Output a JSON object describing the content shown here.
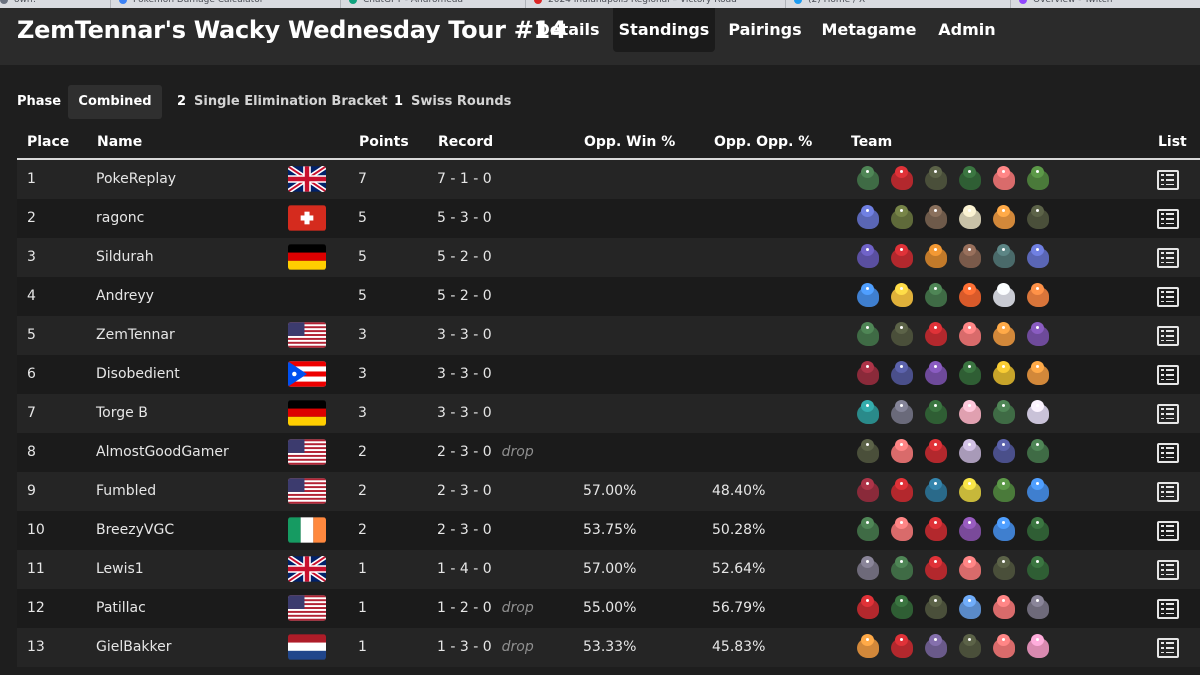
{
  "browser_tabs": [
    {
      "label": "own!",
      "color": "#6b7280"
    },
    {
      "label": "Pokemon Damage Calculator",
      "color": "#3b82f6"
    },
    {
      "label": "ChatGPT - Andromeda",
      "color": "#10a37f"
    },
    {
      "label": "2024 Indianapolis Regional – Victory Road",
      "color": "#dc2626"
    },
    {
      "label": "(2) Home / X",
      "color": "#1d9bf0"
    },
    {
      "label": "Overview - Twitch",
      "color": "#9146ff"
    }
  ],
  "header": {
    "title": "ZemTennar's Wacky Wednesday Tour #14",
    "nav": [
      {
        "label": "Details",
        "active": false
      },
      {
        "label": "Standings",
        "active": true
      },
      {
        "label": "Pairings",
        "active": false
      },
      {
        "label": "Metagame",
        "active": false
      },
      {
        "label": "Admin",
        "active": false
      }
    ]
  },
  "phase": {
    "label": "Phase",
    "options": [
      {
        "number": "",
        "label": "Combined",
        "active": true
      },
      {
        "number": "2",
        "label": "Single Elimination Bracket",
        "active": false
      },
      {
        "number": "1",
        "label": "Swiss Rounds",
        "active": false
      }
    ]
  },
  "table": {
    "columns": {
      "place": "Place",
      "name": "Name",
      "points": "Points",
      "record": "Record",
      "opp_win": "Opp. Win %",
      "opp_opp": "Opp. Opp. %",
      "team": "Team",
      "list": "List"
    },
    "rows": [
      {
        "place": "1",
        "name": "PokeReplay",
        "flag": "uk",
        "points": "7",
        "record": "7 - 1 - 0",
        "drop": "",
        "opp_win": "",
        "opp_opp": "",
        "team": [
          "#3f6b45",
          "#b3282d",
          "#4a4f3a",
          "#2f5e34",
          "#d96b6b",
          "#4a7a3a"
        ]
      },
      {
        "place": "2",
        "name": "ragonc",
        "flag": "ch",
        "points": "5",
        "record": "5 - 3 - 0",
        "drop": "",
        "opp_win": "",
        "opp_opp": "",
        "team": [
          "#5a66b5",
          "#5f6a3a",
          "#6e5a4a",
          "#c9c2a8",
          "#d2883a",
          "#4a4f3a"
        ]
      },
      {
        "place": "3",
        "name": "Sildurah",
        "flag": "de",
        "points": "5",
        "record": "5 - 2 - 0",
        "drop": "",
        "opp_win": "",
        "opp_opp": "",
        "team": [
          "#5a4fa0",
          "#b3282d",
          "#c27a2a",
          "#7a5a4a",
          "#4a6a6a",
          "#5a66b5"
        ]
      },
      {
        "place": "4",
        "name": "Andreyy",
        "flag": "",
        "points": "5",
        "record": "5 - 2 - 0",
        "drop": "",
        "opp_win": "",
        "opp_opp": "",
        "team": [
          "#3f7fcf",
          "#e0b13a",
          "#3f6b45",
          "#d95a2a",
          "#c9cbd3",
          "#d9753a"
        ]
      },
      {
        "place": "5",
        "name": "ZemTennar",
        "flag": "us",
        "points": "3",
        "record": "3 - 3 - 0",
        "drop": "",
        "opp_win": "",
        "opp_opp": "",
        "team": [
          "#3f6b45",
          "#4a4f3a",
          "#b3282d",
          "#d96b6b",
          "#d2883a",
          "#6e4a9a"
        ]
      },
      {
        "place": "6",
        "name": "Disobedient",
        "flag": "pr",
        "points": "3",
        "record": "3 - 3 - 0",
        "drop": "",
        "opp_win": "",
        "opp_opp": "",
        "team": [
          "#8a2a3a",
          "#4a4f8a",
          "#6e4a9a",
          "#2f5e34",
          "#c7a42a",
          "#d2883a"
        ]
      },
      {
        "place": "7",
        "name": "Torge B",
        "flag": "de",
        "points": "3",
        "record": "3 - 3 - 0",
        "drop": "",
        "opp_win": "",
        "opp_opp": "",
        "team": [
          "#2a8a8a",
          "#6a6a7a",
          "#2f5e34",
          "#e0a0b0",
          "#3f6b45",
          "#c9c2d8"
        ]
      },
      {
        "place": "8",
        "name": "AlmostGoodGamer",
        "flag": "us",
        "points": "2",
        "record": "2 - 3 - 0",
        "drop": "drop",
        "opp_win": "",
        "opp_opp": "",
        "team": [
          "#4a4f3a",
          "#d96b6b",
          "#b3282d",
          "#a89ab8",
          "#4a4f8a",
          "#3f6b45"
        ]
      },
      {
        "place": "9",
        "name": "Fumbled",
        "flag": "us",
        "points": "2",
        "record": "2 - 3 - 0",
        "drop": "",
        "opp_win": "57.00%",
        "opp_opp": "48.40%",
        "team": [
          "#8a2a3a",
          "#b3282d",
          "#2a6a8a",
          "#c7b83a",
          "#4a7a3a",
          "#3f7fcf"
        ]
      },
      {
        "place": "10",
        "name": "BreezyVGC",
        "flag": "ie",
        "points": "2",
        "record": "2 - 3 - 0",
        "drop": "",
        "opp_win": "53.75%",
        "opp_opp": "50.28%",
        "team": [
          "#3f6b45",
          "#d96b6b",
          "#b3282d",
          "#7a4a9a",
          "#3f7fcf",
          "#2f5e34"
        ]
      },
      {
        "place": "11",
        "name": "Lewis1",
        "flag": "uk",
        "points": "1",
        "record": "1 - 4 - 0",
        "drop": "",
        "opp_win": "57.00%",
        "opp_opp": "52.64%",
        "team": [
          "#6e6a7a",
          "#3f6b45",
          "#b3282d",
          "#d96b6b",
          "#4a4f3a",
          "#2f5e34"
        ]
      },
      {
        "place": "12",
        "name": "Patillac",
        "flag": "us",
        "points": "1",
        "record": "1 - 2 - 0",
        "drop": "drop",
        "opp_win": "55.00%",
        "opp_opp": "56.79%",
        "team": [
          "#b3282d",
          "#2f5e34",
          "#4a4f3a",
          "#5a8ac8",
          "#d96b6b",
          "#6e6a7a"
        ]
      },
      {
        "place": "13",
        "name": "GielBakker",
        "flag": "nl",
        "points": "1",
        "record": "1 - 3 - 0",
        "drop": "drop",
        "opp_win": "53.33%",
        "opp_opp": "45.83%",
        "team": [
          "#d2883a",
          "#b3282d",
          "#6a5a8a",
          "#4a4f3a",
          "#d96b6b",
          "#d98ab0"
        ]
      }
    ]
  }
}
